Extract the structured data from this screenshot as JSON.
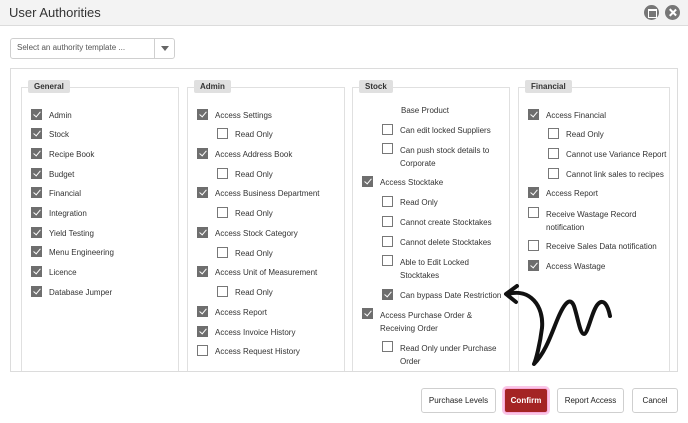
{
  "window": {
    "title": "User Authorities"
  },
  "template_select": {
    "placeholder": "Select an authority template ..."
  },
  "panels": [
    {
      "title": "General",
      "items": [
        {
          "label": "Admin",
          "checked": true
        },
        {
          "label": "Stock",
          "checked": true
        },
        {
          "label": "Recipe Book",
          "checked": true
        },
        {
          "label": "Budget",
          "checked": true
        },
        {
          "label": "Financial",
          "checked": true
        },
        {
          "label": "Integration",
          "checked": true
        },
        {
          "label": "Yield Testing",
          "checked": true
        },
        {
          "label": "Menu Engineering",
          "checked": true
        },
        {
          "label": "Licence",
          "checked": true
        },
        {
          "label": "Database Jumper",
          "checked": true
        }
      ]
    },
    {
      "title": "Admin",
      "items": [
        {
          "label": "Access Settings",
          "checked": true
        },
        {
          "label": "Read Only",
          "checked": false
        },
        {
          "label": "Access Address Book",
          "checked": true
        },
        {
          "label": "Read Only",
          "checked": false
        },
        {
          "label": "Access Business Department",
          "checked": true
        },
        {
          "label": "Read Only",
          "checked": false
        },
        {
          "label": "Access Stock Category",
          "checked": true
        },
        {
          "label": "Read Only",
          "checked": false
        },
        {
          "label": "Access Unit of Measurement",
          "checked": true
        },
        {
          "label": "Read Only",
          "checked": false
        },
        {
          "label": "Access Report",
          "checked": true
        },
        {
          "label": "Access Invoice History",
          "checked": true
        },
        {
          "label": "Access Request History",
          "checked": false
        }
      ]
    },
    {
      "title": "Stock",
      "items": [
        {
          "label": "Base Product"
        },
        {
          "label": "Can edit locked Suppliers",
          "checked": false
        },
        {
          "label": "Can push stock details to Corporate",
          "checked": false
        },
        {
          "label": "Access Stocktake",
          "checked": true
        },
        {
          "label": "Read Only",
          "checked": false
        },
        {
          "label": "Cannot create Stocktakes",
          "checked": false
        },
        {
          "label": "Cannot delete Stocktakes",
          "checked": false
        },
        {
          "label": "Able to Edit Locked Stocktakes",
          "checked": false
        },
        {
          "label": "Can bypass Date Restriction",
          "checked": true
        },
        {
          "label": "Access Purchase Order & Receiving Order",
          "checked": true
        },
        {
          "label": "Read Only under Purchase Order",
          "checked": false
        }
      ]
    },
    {
      "title": "Financial",
      "items": [
        {
          "label": "Access Financial",
          "checked": true
        },
        {
          "label": "Read Only",
          "checked": false
        },
        {
          "label": "Cannot use Variance Report",
          "checked": false
        },
        {
          "label": "Cannot link sales to recipes",
          "checked": false
        },
        {
          "label": "Access Report",
          "checked": true
        },
        {
          "label": "Receive Wastage Record notification",
          "checked": false
        },
        {
          "label": "Receive Sales Data notification",
          "checked": false
        },
        {
          "label": "Access Wastage",
          "checked": true
        }
      ]
    }
  ],
  "buttons": {
    "purchase_levels": "Purchase Levels",
    "confirm": "Confirm",
    "report_access": "Report Access",
    "cancel": "Cancel"
  },
  "colors": {
    "confirm_bg": "#a42424",
    "checkbox_checked": "#6e6e6e",
    "annotation_arrow": "#111111"
  },
  "annotation": {
    "icon": "hand-drawn-arrow-icon",
    "points_to": "Can bypass Date Restriction"
  }
}
